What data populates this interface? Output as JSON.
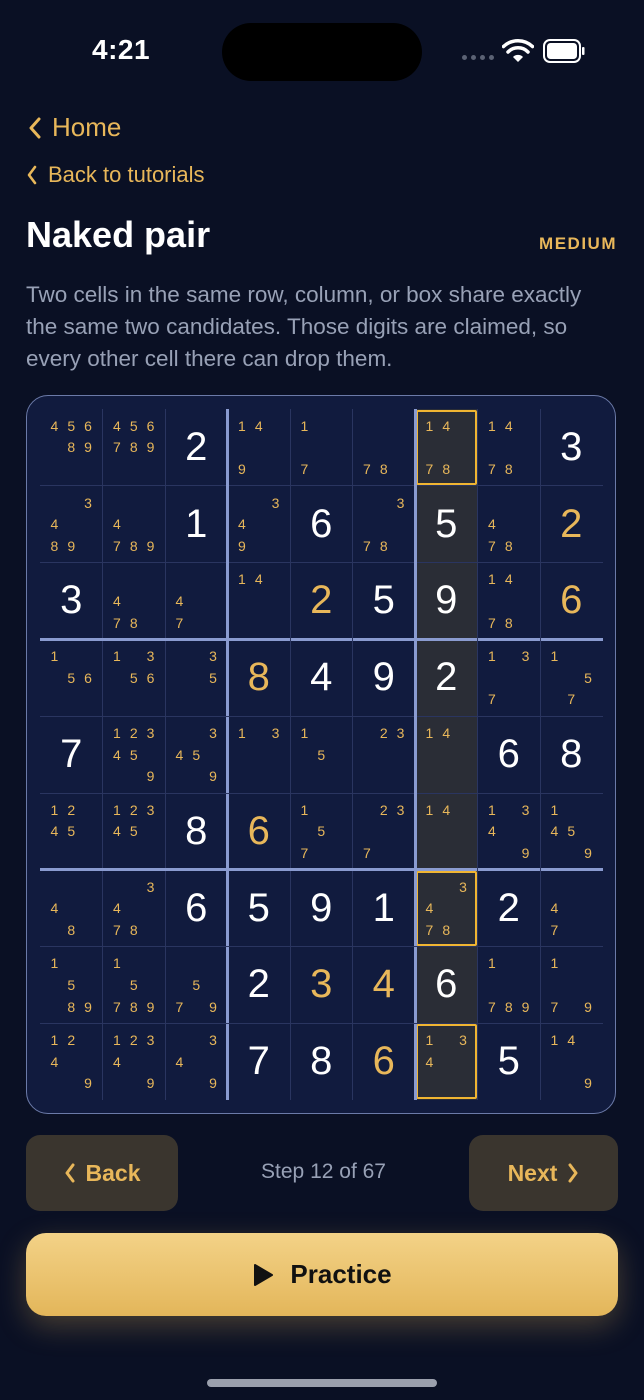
{
  "status": {
    "time": "4:21"
  },
  "nav": {
    "home_label": "Home",
    "back_tutorials_label": "Back to tutorials"
  },
  "page": {
    "title": "Naked pair",
    "difficulty": "MEDIUM",
    "description": "Two cells in the same row, column, or box share exactly the same two candidates. Those digits are claimed, so every other cell there can drop them."
  },
  "board": {
    "cells": [
      [
        {
          "c": "456 89"
        },
        {
          "c": "456789"
        },
        {
          "v": "2",
          "t": "given"
        },
        {
          "c": "14    9"
        },
        {
          "c": "1     7"
        },
        {
          "c": "      78"
        },
        {
          "c": "14    78",
          "sel": true
        },
        {
          "c": "14    78"
        },
        {
          "v": "3",
          "t": "given"
        }
      ],
      [
        {
          "c": "  34  89"
        },
        {
          "c": "   4  789"
        },
        {
          "v": "1",
          "t": "given"
        },
        {
          "c": "  34  9"
        },
        {
          "v": "6",
          "t": "given"
        },
        {
          "c": "  3   78"
        },
        {
          "v": "5",
          "t": "given"
        },
        {
          "c": "   4  78"
        },
        {
          "v": "2",
          "t": "user"
        }
      ],
      [
        {
          "v": "3",
          "t": "given"
        },
        {
          "c": "   4  78"
        },
        {
          "c": "   4  7"
        },
        {
          "c": "14"
        },
        {
          "v": "2",
          "t": "user"
        },
        {
          "v": "5",
          "t": "given"
        },
        {
          "v": "9",
          "t": "given"
        },
        {
          "c": "14    78"
        },
        {
          "v": "6",
          "t": "user"
        }
      ],
      [
        {
          "c": "1   56"
        },
        {
          "c": "1 3 56"
        },
        {
          "c": "  3  5"
        },
        {
          "v": "8",
          "t": "user"
        },
        {
          "v": "4",
          "t": "given"
        },
        {
          "v": "9",
          "t": "given"
        },
        {
          "v": "2",
          "t": "given"
        },
        {
          "c": "1 3   7"
        },
        {
          "c": "1    5 7"
        }
      ],
      [
        {
          "v": "7",
          "t": "given"
        },
        {
          "c": "12345   9"
        },
        {
          "c": "  345   9"
        },
        {
          "c": "1 3"
        },
        {
          "c": "1   5"
        },
        {
          "c": " 23"
        },
        {
          "c": "14"
        },
        {
          "v": "6",
          "t": "given"
        },
        {
          "v": "8",
          "t": "given"
        }
      ],
      [
        {
          "c": "12 45"
        },
        {
          "c": "12345"
        },
        {
          "v": "8",
          "t": "given"
        },
        {
          "v": "6",
          "t": "user"
        },
        {
          "c": "1   5 7"
        },
        {
          "c": " 23   7"
        },
        {
          "c": "14"
        },
        {
          "c": "1 34    9"
        },
        {
          "c": "1  45   9"
        }
      ],
      [
        {
          "c": "   4   8"
        },
        {
          "c": "  34  78"
        },
        {
          "v": "6",
          "t": "given"
        },
        {
          "v": "5",
          "t": "given"
        },
        {
          "v": "9",
          "t": "given"
        },
        {
          "v": "1",
          "t": "given"
        },
        {
          "c": "  34  78",
          "sel": true
        },
        {
          "v": "2",
          "t": "given"
        },
        {
          "c": "   4  7"
        }
      ],
      [
        {
          "c": "1   5  89"
        },
        {
          "c": "1   5 789"
        },
        {
          "c": "    5 7 9"
        },
        {
          "v": "2",
          "t": "given"
        },
        {
          "v": "3",
          "t": "user"
        },
        {
          "v": "4",
          "t": "user"
        },
        {
          "v": "6",
          "t": "given"
        },
        {
          "c": "1     789"
        },
        {
          "c": "1     7 9"
        }
      ],
      [
        {
          "c": "12 4    9"
        },
        {
          "c": "1234    9"
        },
        {
          "c": "  34    9"
        },
        {
          "v": "7",
          "t": "given"
        },
        {
          "v": "8",
          "t": "given"
        },
        {
          "v": "6",
          "t": "user"
        },
        {
          "c": "1 34",
          "sel": true
        },
        {
          "v": "5",
          "t": "given"
        },
        {
          "c": "14      9"
        }
      ]
    ]
  },
  "controls": {
    "back_label": "Back",
    "step_label": "Step 12 of 67",
    "next_label": "Next",
    "practice_label": "Practice"
  },
  "colors": {
    "background": "#0a1024",
    "accent": "#e8b75a",
    "highlight": "#f0b532",
    "grid_major": "#8a9bd0",
    "grid_minor": "#2a3560"
  }
}
